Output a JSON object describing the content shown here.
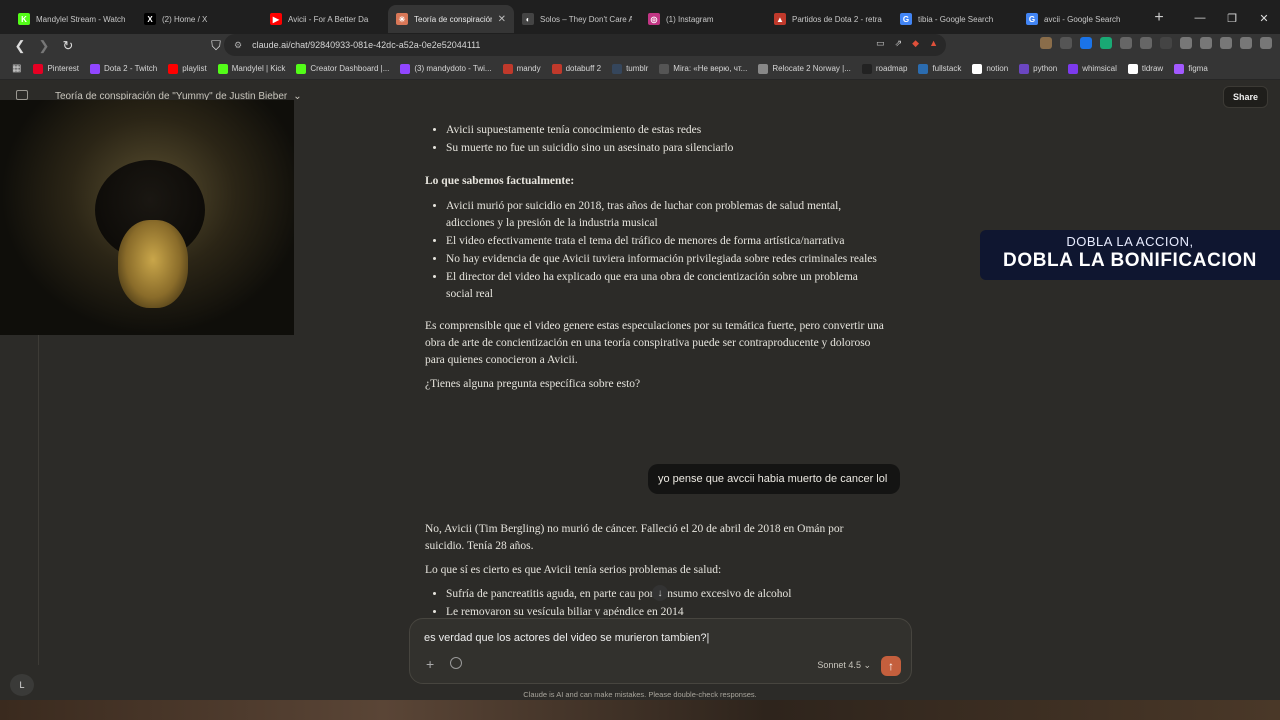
{
  "browser": {
    "tabs": [
      {
        "title": "Mandylel Stream - Watch",
        "icon_color": "#53fc18",
        "icon_char": "K"
      },
      {
        "title": "(2) Home / X",
        "icon_color": "#000000",
        "icon_char": "X"
      },
      {
        "title": "Avicii - For A Better Da",
        "icon_color": "#ff0000",
        "icon_char": "▶"
      },
      {
        "title": "Teoría de conspiración",
        "icon_color": "#d97757",
        "icon_char": "✳"
      },
      {
        "title": "Solos – They Don't Care A",
        "icon_color": "#444444",
        "icon_char": "◐"
      },
      {
        "title": "(1) Instagram",
        "icon_color": "#c13584",
        "icon_char": "◎"
      },
      {
        "title": "Partidos de Dota 2 - retra",
        "icon_color": "#c0392b",
        "icon_char": "▲"
      },
      {
        "title": "tibia - Google Search",
        "icon_color": "#4285f4",
        "icon_char": "G"
      },
      {
        "title": "avcii - Google Search",
        "icon_color": "#4285f4",
        "icon_char": "G"
      }
    ],
    "active_tab_index": 3,
    "url": "claude.ai/chat/92840933-081e-42dc-a52a-0e2e52044111",
    "bookmarks": [
      {
        "label": "Pinterest",
        "color": "#e60023"
      },
      {
        "label": "Dota 2 - Twitch",
        "color": "#9146ff"
      },
      {
        "label": "playlist",
        "color": "#ff0000"
      },
      {
        "label": "Mandylel | Kick",
        "color": "#53fc18"
      },
      {
        "label": "Creator Dashboard |...",
        "color": "#53fc18"
      },
      {
        "label": "(3) mandydoto - Twi...",
        "color": "#9146ff"
      },
      {
        "label": "mandy",
        "color": "#c0392b"
      },
      {
        "label": "dotabuff 2",
        "color": "#c0392b"
      },
      {
        "label": "tumblr",
        "color": "#35465c"
      },
      {
        "label": "Mira: «Не верю, чт...",
        "color": "#555555"
      },
      {
        "label": "Relocate 2 Norway |...",
        "color": "#888888"
      },
      {
        "label": "roadmap",
        "color": "#222222"
      },
      {
        "label": "fullstack",
        "color": "#2b6cb0"
      },
      {
        "label": "notion",
        "color": "#ffffff"
      },
      {
        "label": "python",
        "color": "#6b46c1"
      },
      {
        "label": "whimsical",
        "color": "#7c3aed"
      },
      {
        "label": "tldraw",
        "color": "#ffffff"
      },
      {
        "label": "figma",
        "color": "#a259ff"
      }
    ]
  },
  "app": {
    "conversation_title": "Teoría de conspiración de \"Yummy\" de Justin Bieber",
    "share_label": "Share",
    "avatar_initial": "L"
  },
  "messages": {
    "top_bullets": [
      "Avicii supuestamente tenía conocimiento de estas redes",
      "Su muerte no fue un suicidio sino un asesinato para silenciarlo"
    ],
    "facts_heading": "Lo que sabemos factualmente:",
    "facts": [
      "Avicii murió por suicidio en 2018, tras años de luchar con problemas de salud mental, adicciones y la presión de la industria musical",
      "El video efectivamente trata el tema del tráfico de menores de forma artística/narrativa",
      "No hay evidencia de que Avicii tuviera información privilegiada sobre redes criminales reales",
      "El director del video ha explicado que era una obra de concientización sobre un problema social real"
    ],
    "para1": "Es comprensible que el video genere estas especulaciones por su temática fuerte, pero convertir una obra de arte de concientización en una teoría conspirativa puede ser contraproducente y doloroso para quienes conocieron a Avicii.",
    "para2": "¿Tienes alguna pregunta específica sobre esto?",
    "user_message": "yo pense que avccii habia muerto de cancer lol",
    "reply_para": "No, Avicii (Tim Bergling) no murió de cáncer. Falleció el 20 de abril de 2018 en Omán por suicidio. Tenía 28 años.",
    "reply_heading": "Lo que sí es cierto es que Avicii tenía serios problemas de salud:",
    "reply_bullets": [
      "Sufría de pancreatitis aguda, en parte cau  por consumo excesivo de alcohol",
      "Le removaron su vesícula biliar y apéndice en 2014"
    ]
  },
  "composer": {
    "input_value": "es verdad que los actores del video se murieron tambien?",
    "model_label": "Sonnet 4.5"
  },
  "disclaimer": "Claude is AI and can make mistakes. Please double-check responses.",
  "overlay": {
    "promo_line1": "DOBLA LA ACCION,",
    "promo_line2": "DOBLA LA BONIFICACION"
  }
}
